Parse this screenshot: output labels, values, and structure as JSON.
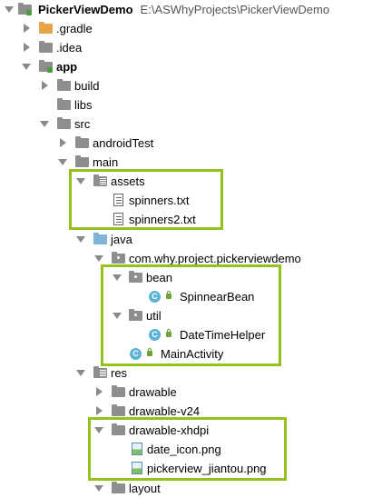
{
  "project": {
    "name": "PickerViewDemo",
    "path": "E:\\ASWhyProjects\\PickerViewDemo"
  },
  "tree": {
    "gradle": ".gradle",
    "idea": ".idea",
    "app": "app",
    "build": "build",
    "libs": "libs",
    "src": "src",
    "androidTest": "androidTest",
    "main": "main",
    "assets": "assets",
    "spinners_txt": "spinners.txt",
    "spinners2_txt": "spinners2.txt",
    "java": "java",
    "package": "com.why.project.pickerviewdemo",
    "bean": "bean",
    "spinnear_bean": "SpinnearBean",
    "util": "util",
    "date_time_helper": "DateTimeHelper",
    "main_activity": "MainActivity",
    "res": "res",
    "drawable": "drawable",
    "drawable_v24": "drawable-v24",
    "drawable_xhdpi": "drawable-xhdpi",
    "date_icon": "date_icon.png",
    "pickerview_jiantou": "pickerview_jiantou.png",
    "layout": "layout"
  },
  "class_icon_letter": "C",
  "highlight_color": "#95c11f"
}
